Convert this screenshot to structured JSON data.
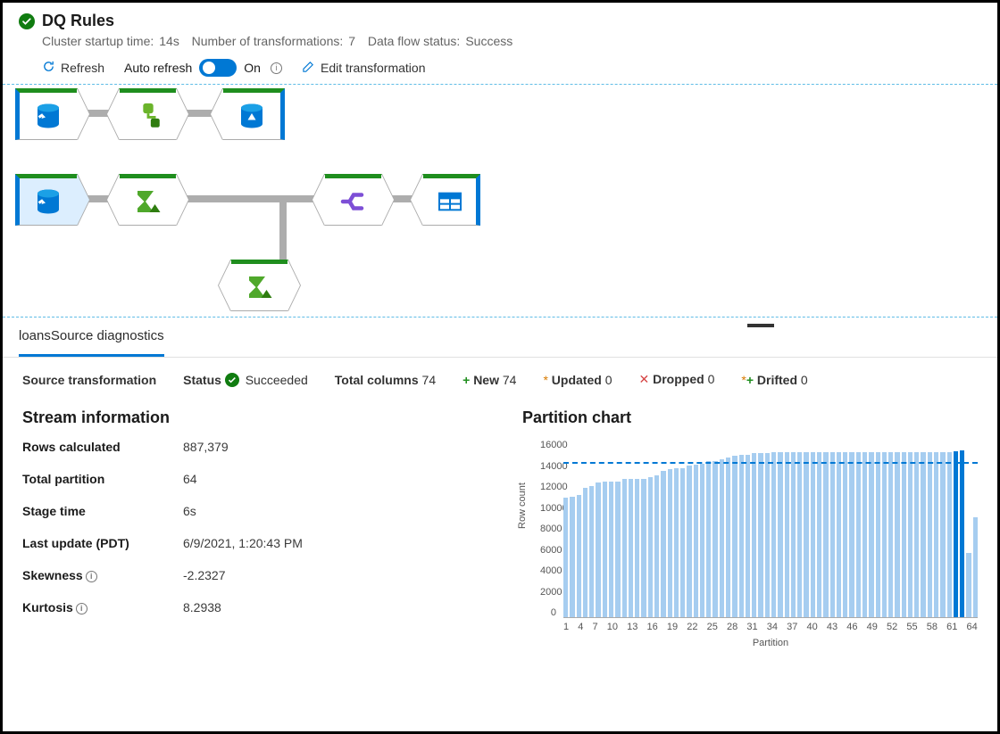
{
  "header": {
    "title": "DQ Rules",
    "cluster_label": "Cluster startup time:",
    "cluster_val": "14s",
    "transform_label": "Number of transformations:",
    "transform_val": "7",
    "flow_label": "Data flow status:",
    "flow_val": "Success"
  },
  "toolbar": {
    "refresh": "Refresh",
    "auto_refresh": "Auto refresh",
    "on": "On",
    "edit": "Edit transformation"
  },
  "tabs": {
    "diag": "loansSource diagnostics"
  },
  "status": {
    "source": "Source transformation",
    "status_label": "Status",
    "status_val": "Succeeded",
    "total_label": "Total columns",
    "total_val": "74",
    "new_label": "New",
    "new_val": "74",
    "updated_label": "Updated",
    "updated_val": "0",
    "dropped_label": "Dropped",
    "dropped_val": "0",
    "drifted_label": "Drifted",
    "drifted_val": "0"
  },
  "stream": {
    "title": "Stream information",
    "rows_k": "Rows calculated",
    "rows_v": "887,379",
    "part_k": "Total partition",
    "part_v": "64",
    "stage_k": "Stage time",
    "stage_v": "6s",
    "last_k": "Last update (PDT)",
    "last_v": "6/9/2021, 1:20:43 PM",
    "skew_k": "Skewness",
    "skew_v": "-2.2327",
    "kurt_k": "Kurtosis",
    "kurt_v": "8.2938"
  },
  "chart_data": {
    "type": "bar",
    "title": "Partition chart",
    "xlabel": "Partition",
    "ylabel": "Row count",
    "ylim": [
      0,
      16000
    ],
    "ref_line": 13800,
    "x_ticks": [
      1,
      4,
      7,
      10,
      13,
      16,
      19,
      22,
      25,
      28,
      31,
      34,
      37,
      40,
      43,
      46,
      49,
      52,
      55,
      58,
      61,
      64
    ],
    "y_ticks": [
      0,
      2000,
      4000,
      6000,
      8000,
      10000,
      12000,
      14000,
      16000
    ],
    "categories": [
      1,
      2,
      3,
      4,
      5,
      6,
      7,
      8,
      9,
      10,
      11,
      12,
      13,
      14,
      15,
      16,
      17,
      18,
      19,
      20,
      21,
      22,
      23,
      24,
      25,
      26,
      27,
      28,
      29,
      30,
      31,
      32,
      33,
      34,
      35,
      36,
      37,
      38,
      39,
      40,
      41,
      42,
      43,
      44,
      45,
      46,
      47,
      48,
      49,
      50,
      51,
      52,
      53,
      54,
      55,
      56,
      57,
      58,
      59,
      60,
      61,
      62,
      63,
      64
    ],
    "values": [
      10700,
      10800,
      11000,
      11600,
      11800,
      12100,
      12200,
      12200,
      12200,
      12400,
      12400,
      12400,
      12400,
      12600,
      12700,
      13100,
      13300,
      13400,
      13400,
      13600,
      13700,
      13800,
      14000,
      14000,
      14200,
      14300,
      14500,
      14600,
      14600,
      14700,
      14700,
      14700,
      14800,
      14800,
      14800,
      14800,
      14800,
      14800,
      14800,
      14800,
      14800,
      14800,
      14800,
      14800,
      14800,
      14800,
      14800,
      14800,
      14800,
      14800,
      14800,
      14800,
      14800,
      14800,
      14800,
      14800,
      14800,
      14800,
      14800,
      14800,
      14900,
      15000,
      5800,
      9000
    ],
    "highlight": [
      61,
      62
    ]
  }
}
